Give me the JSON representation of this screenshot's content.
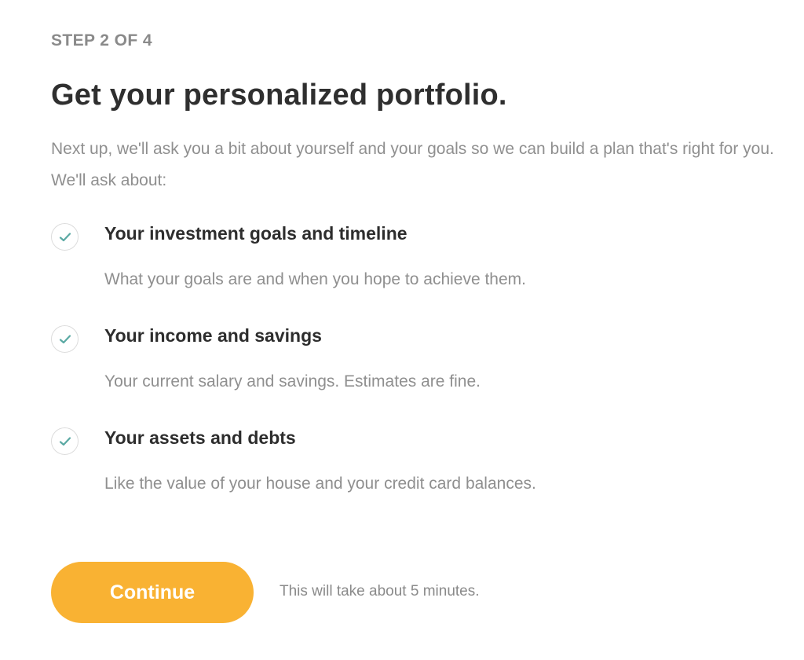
{
  "step_label": "STEP 2 OF 4",
  "title": "Get your personalized portfolio.",
  "intro": "Next up, we'll ask you a bit about yourself and your goals so we can build a plan that's right for you. We'll ask about:",
  "items": [
    {
      "title": "Your investment goals and timeline",
      "description": "What your goals are and when you hope to achieve them."
    },
    {
      "title": "Your income and savings",
      "description": "Your current salary and savings. Estimates are fine."
    },
    {
      "title": "Your assets and debts",
      "description": "Like the value of your house and your credit card balances."
    }
  ],
  "continue_label": "Continue",
  "duration_note": "This will take about 5 minutes.",
  "colors": {
    "accent": "#f9b233",
    "check": "#5aa9a3"
  },
  "icons": {
    "check": "check-icon"
  }
}
